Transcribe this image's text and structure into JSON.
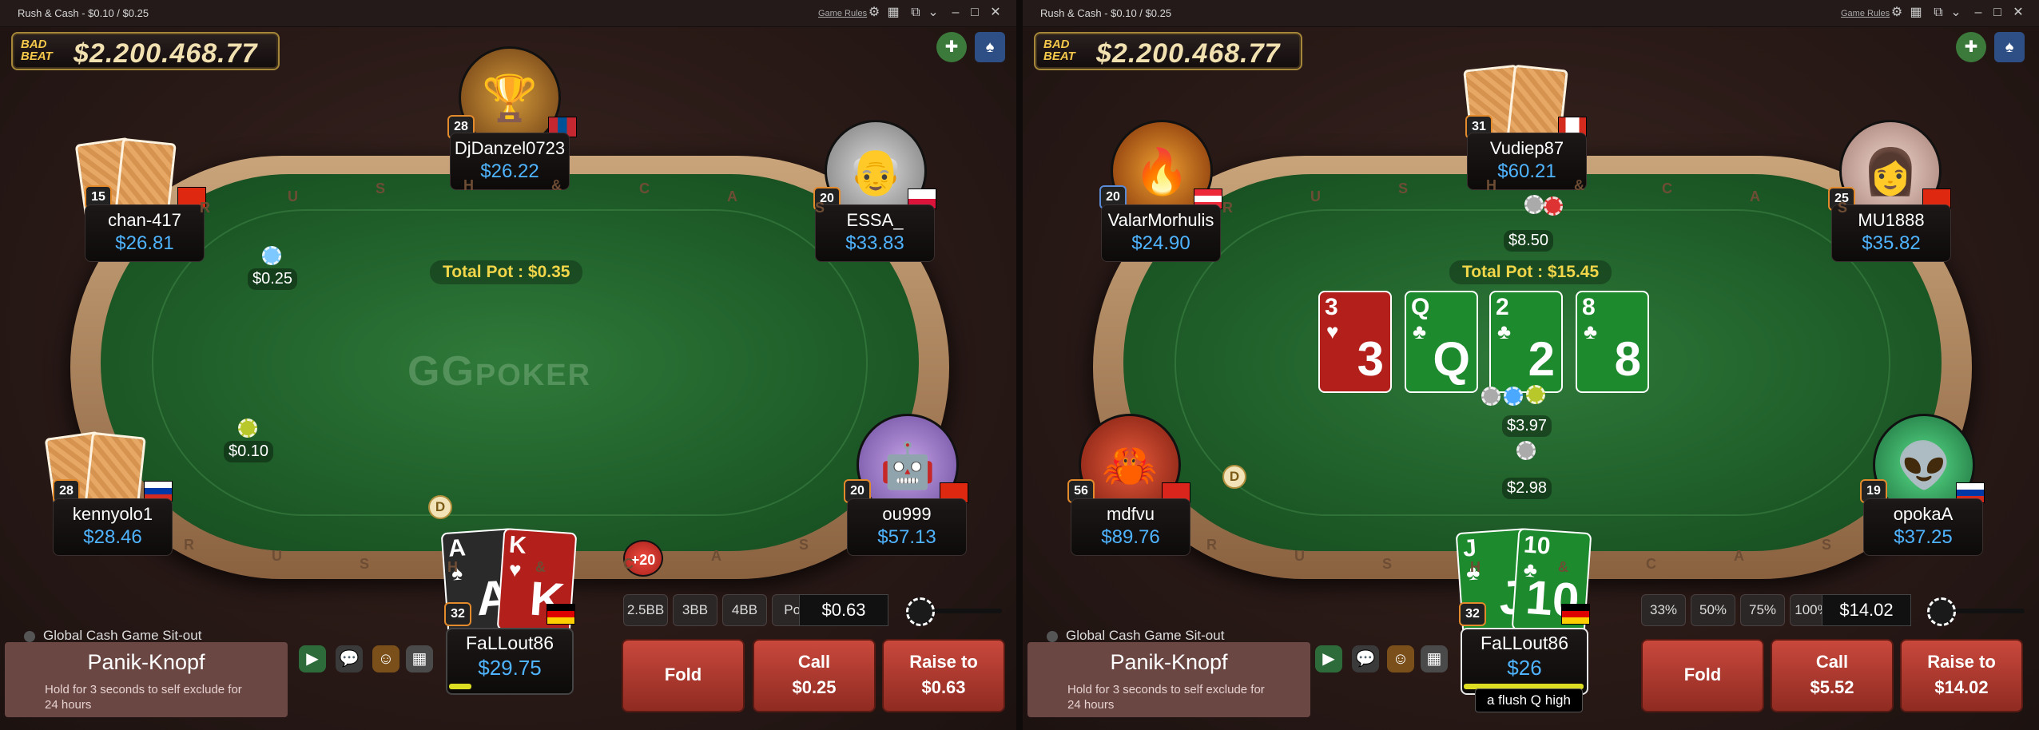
{
  "left": {
    "title": "Rush & Cash - $0.10 / $0.25",
    "game_rules": "Game Rules",
    "badbeat": {
      "label": "BAD BEAT",
      "amount": "$2.200.468.77"
    },
    "total_pot": "Total Pot : $0.35",
    "logo": "GG",
    "logo2": "POKER",
    "bets": [
      "$0.25",
      "$0.10"
    ],
    "dealer": "D",
    "players": [
      {
        "name": "DjDanzel0723",
        "stack": "$26.22",
        "level": "28",
        "avatar": "trophy-basket-icon"
      },
      {
        "name": "chan-417",
        "stack": "$26.81",
        "level": "15"
      },
      {
        "name": "ESSA_",
        "stack": "$33.83",
        "level": "20",
        "avatar": "einstein-avatar-icon"
      },
      {
        "name": "kennyolo1",
        "stack": "$28.46",
        "level": "28"
      },
      {
        "name": "ou999",
        "stack": "$57.13",
        "level": "20",
        "avatar": "robot-3d-glasses-icon"
      }
    ],
    "hero": {
      "name": "FaLLout86",
      "stack": "$29.75",
      "level": "32",
      "cards": [
        {
          "rank": "A",
          "suit": "♠",
          "color": "#2a2a2a"
        },
        {
          "rank": "K",
          "suit": "♥",
          "color": "#b3201c"
        }
      ]
    },
    "plus20": "+20",
    "presets": [
      "2.5BB",
      "3BB",
      "4BB",
      "Pot"
    ],
    "bet_amount": "$0.63",
    "sitout": "Global Cash Game Sit-out",
    "panik": {
      "title": "Panik-Knopf",
      "desc": "Hold for 3 seconds to self exclude for 24 hours"
    },
    "actions": {
      "fold": "Fold",
      "call": "Call",
      "call_amt": "$0.25",
      "raise": "Raise to",
      "raise_amt": "$0.63"
    }
  },
  "right": {
    "title": "Rush & Cash - $0.10 / $0.25",
    "game_rules": "Game Rules",
    "badbeat": {
      "label": "BAD BEAT",
      "amount": "$2.200.468.77"
    },
    "total_pot": "Total Pot : $15.45",
    "bets": [
      "$8.50",
      "$3.97",
      "$2.98"
    ],
    "dealer": "D",
    "board": [
      {
        "rank": "3",
        "suit": "♥",
        "color": "#b3201c"
      },
      {
        "rank": "Q",
        "suit": "♣",
        "color": "#1e8a2e"
      },
      {
        "rank": "2",
        "suit": "♣",
        "color": "#1e8a2e"
      },
      {
        "rank": "8",
        "suit": "♣",
        "color": "#1e8a2e"
      }
    ],
    "players": [
      {
        "name": "Vudiep87",
        "stack": "$60.21",
        "level": "31"
      },
      {
        "name": "ValarMorhulis",
        "stack": "$24.90",
        "level": "20",
        "avatar": "phoenix-avatar-icon"
      },
      {
        "name": "MU1888",
        "stack": "$35.82",
        "level": "25",
        "avatar": "person-photo-avatar-icon"
      },
      {
        "name": "mdfvu",
        "stack": "$89.76",
        "level": "56",
        "avatar": "crab-avatar-icon"
      },
      {
        "name": "opokaA",
        "stack": "$37.25",
        "level": "19",
        "avatar": "green-alien-avatar-icon"
      }
    ],
    "hero": {
      "name": "FaLLout86",
      "stack": "$26",
      "level": "32",
      "hand_label": "a flush Q high",
      "cards": [
        {
          "rank": "J",
          "suit": "♣",
          "color": "#1e8a2e"
        },
        {
          "rank": "10",
          "suit": "♣",
          "color": "#1e8a2e"
        }
      ]
    },
    "presets": [
      "33%",
      "50%",
      "75%",
      "100%"
    ],
    "bet_amount": "$14.02",
    "sitout": "Global Cash Game Sit-out",
    "panik": {
      "title": "Panik-Knopf",
      "desc": "Hold for 3 seconds to self exclude for 24 hours"
    },
    "actions": {
      "fold": "Fold",
      "call": "Call",
      "call_amt": "$5.52",
      "raise": "Raise to",
      "raise_amt": "$14.02"
    }
  },
  "rail_letters": "R U S H & C A S H",
  "colors": {
    "felt": "#1e5c28",
    "stack_blue": "#4fb4ff",
    "pot_yellow": "#f2d64a",
    "action_red": "#b83a30",
    "level_orange": "#e28a2c"
  }
}
